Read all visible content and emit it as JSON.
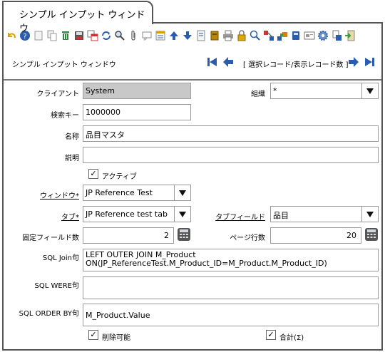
{
  "window": {
    "tab_title": "シンプル インプット ウィンドウ",
    "name": "シンプル インプット ウィンドウ"
  },
  "navigation": {
    "status": "[ 選択レコード/表示レコード数 ]"
  },
  "toolbar": {
    "icons": [
      "undo-icon",
      "help-icon",
      "new-record-icon",
      "copy-record-icon",
      "delete-icon",
      "save-icon",
      "grid-toggle-icon",
      "refresh-icon",
      "find-icon",
      "attachment-icon",
      "chat-icon",
      "history-icon",
      "parent-record-icon",
      "detail-record-icon",
      "report-icon",
      "archive-icon",
      "print-icon",
      "lock-icon",
      "zoom-across-icon",
      "related-info-icon",
      "workflow-icon",
      "product-info-icon",
      "window-icon",
      "settings-icon",
      "export-icon",
      "exit-icon"
    ]
  },
  "form": {
    "client": {
      "label": "クライアント",
      "value": "System"
    },
    "org": {
      "label": "組織",
      "value": "*"
    },
    "search_key": {
      "label": "検索キー",
      "value": "1000000"
    },
    "name": {
      "label": "名称",
      "value": "品目マスタ"
    },
    "description": {
      "label": "説明",
      "value": ""
    },
    "active": {
      "label": "アクティブ",
      "checked": true
    },
    "window": {
      "label": "ウィンドウ*",
      "value": "JP Reference Test"
    },
    "tab": {
      "label": "タブ*",
      "value": "JP Reference test tab"
    },
    "tab_field": {
      "label": "タブフィールド",
      "value": "品目"
    },
    "fixed_fields": {
      "label": "固定フィールド数",
      "value": "2"
    },
    "page_rows": {
      "label": "ページ行数",
      "value": "20"
    },
    "sql_join": {
      "label": "SQL Join句",
      "line1": "LEFT OUTER JOIN M_Product",
      "line2": "ON(JP_ReferenceTest.M_Product_ID=M_Product.M_Product_ID)"
    },
    "sql_where": {
      "label": "SQL WERE句",
      "value": ""
    },
    "sql_order_by": {
      "label": "SQL ORDER BY句",
      "value": "M_Product.Value"
    },
    "deletable": {
      "label": "削除可能",
      "checked": true
    },
    "summary": {
      "label": "合計(Σ)",
      "checked": true
    }
  },
  "colors": {
    "accent_blue": "#2a5db0",
    "frame_border": "#555555",
    "readonly_bg": "#c8c8c8"
  }
}
